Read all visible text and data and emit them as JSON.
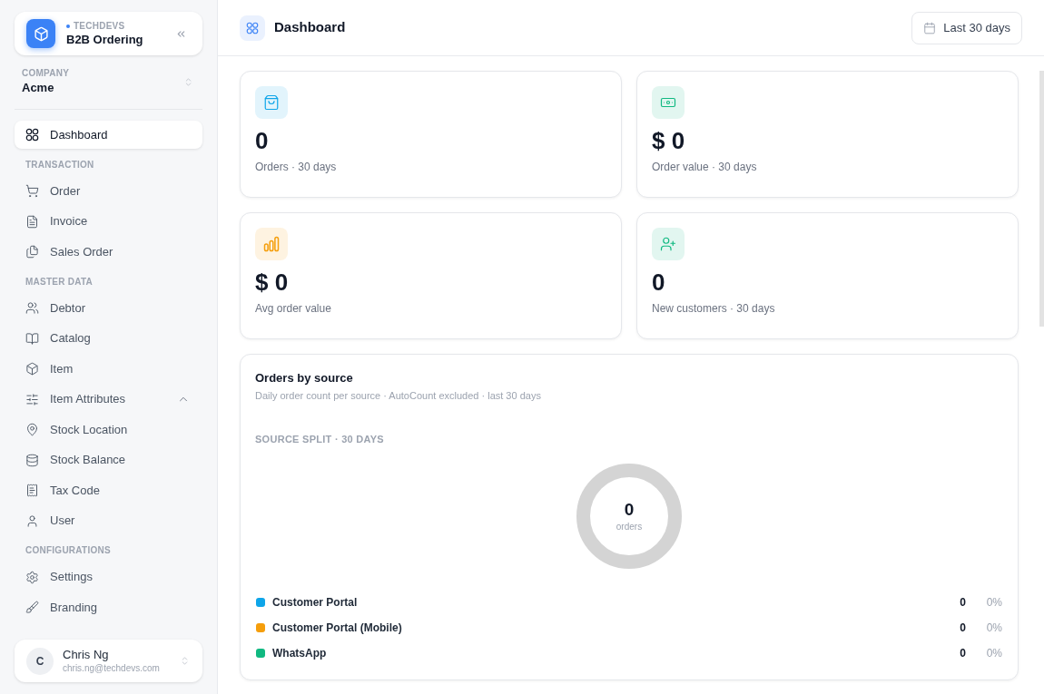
{
  "sidebar": {
    "brand": {
      "org": "TECHDEVS",
      "app": "B2B Ordering"
    },
    "company": {
      "label": "COMPANY",
      "value": "Acme"
    },
    "nav": [
      {
        "items": [
          {
            "kind": "link",
            "label": "Dashboard",
            "selected": true
          }
        ]
      },
      {
        "title": "TRANSACTION",
        "items": [
          {
            "kind": "link",
            "label": "Order",
            "selected": false
          },
          {
            "kind": "link",
            "label": "Invoice",
            "selected": false
          },
          {
            "kind": "link",
            "label": "Sales Order",
            "selected": false
          }
        ]
      },
      {
        "title": "MASTER DATA",
        "items": [
          {
            "kind": "link",
            "label": "Debtor",
            "selected": false
          },
          {
            "kind": "link",
            "label": "Catalog",
            "selected": false
          },
          {
            "kind": "link",
            "label": "Item",
            "selected": false
          },
          {
            "kind": "group",
            "label": "Item Attributes",
            "selected": false,
            "expanded": true
          },
          {
            "kind": "link",
            "label": "Stock Location",
            "selected": false
          },
          {
            "kind": "link",
            "label": "Stock Balance",
            "selected": false
          },
          {
            "kind": "link",
            "label": "Tax Code",
            "selected": false
          },
          {
            "kind": "link",
            "label": "User",
            "selected": false
          }
        ]
      },
      {
        "title": "CONFIGURATIONS",
        "items": [
          {
            "kind": "link",
            "label": "Settings",
            "selected": false
          },
          {
            "kind": "link",
            "label": "Branding",
            "selected": false
          }
        ]
      }
    ],
    "user": {
      "initial": "C",
      "name": "Chris Ng",
      "email": "chris.ng@techdevs.com"
    }
  },
  "header": {
    "title": "Dashboard",
    "range_button": "Last 30 days"
  },
  "stats": [
    {
      "value": "0",
      "label": "Orders · 30 days",
      "color": "#0ea5e9"
    },
    {
      "value": "$ 0",
      "label": "Order value · 30 days",
      "color": "#10b981"
    },
    {
      "value": "$ 0",
      "label": "Avg order value",
      "color": "#f59e0b"
    },
    {
      "value": "0",
      "label": "New customers · 30 days",
      "color": "#10b981"
    }
  ],
  "orders_by_source": {
    "title": "Orders by source",
    "subtitle": "Daily order count per source · AutoCount excluded · last 30 days",
    "split_label": "SOURCE SPLIT · 30 DAYS",
    "donut": {
      "total": "0",
      "unit": "orders"
    },
    "sources": [
      {
        "name": "Customer Portal",
        "color": "#0ea5e9",
        "count": "0",
        "percent": "0%"
      },
      {
        "name": "Customer Portal (Mobile)",
        "color": "#f59e0b",
        "count": "0",
        "percent": "0%"
      },
      {
        "name": "WhatsApp",
        "color": "#10b981",
        "count": "0",
        "percent": "0%"
      }
    ]
  }
}
